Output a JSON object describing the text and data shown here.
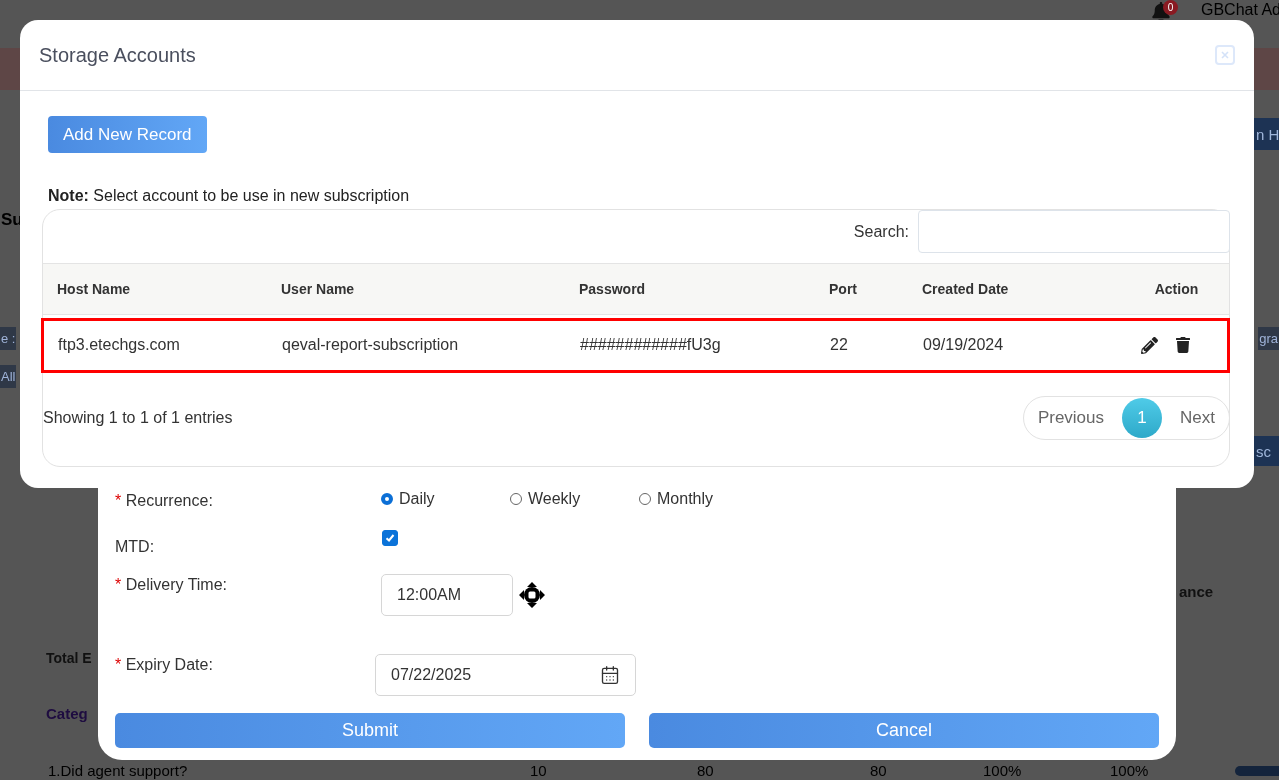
{
  "background_page": {
    "notification_badge": "0",
    "user_label": "GBChat Ad",
    "top_button": "n H",
    "heading": "Su",
    "left_chips": [
      "e :",
      "All"
    ],
    "right_chip": "gra",
    "right_button": "sc",
    "side_header": "ance",
    "total_label": "Total E",
    "category_label": "Categ",
    "progress_bar": {
      "level": 1
    },
    "table_row": [
      "1.Did agent support?",
      "10",
      "80",
      "80",
      "100%",
      "100%"
    ]
  },
  "subscription_form": {
    "fields": [
      {
        "kind": "radio",
        "required_mark": "*",
        "label": "Recurrence:",
        "options": [
          {
            "label": "Daily",
            "selected": true
          },
          {
            "label": "Weekly",
            "selected": false
          },
          {
            "label": "Monthly",
            "selected": false
          }
        ]
      },
      {
        "kind": "checkbox",
        "label": "MTD:",
        "checked": true
      },
      {
        "kind": "time",
        "required_mark": "*",
        "label": "Delivery Time:",
        "value": "12:00AM"
      },
      {
        "kind": "date",
        "required_mark": "*",
        "label": "Expiry Date:",
        "value": "07/22/2025"
      }
    ],
    "buttons": [
      "Submit",
      "Cancel"
    ]
  },
  "storage_modal": {
    "title": "Storage Accounts",
    "add_button": "Add New Record",
    "note": "**Note:** Select account to be use in new subscription",
    "search_label": "Search:",
    "columns": [
      "Host Name",
      "User Name",
      "Password",
      "Port",
      "Created Date",
      "Action"
    ],
    "rows": [
      {
        "selected": true,
        "cells": [
          "ftp3.etechgs.com",
          "qeval-report-subscription",
          "############fU3g",
          "22",
          "09/19/2024"
        ]
      }
    ],
    "info": "Showing 1 to 1 of 1 entries",
    "pagination": [
      {
        "label": "Previous",
        "selected": false
      },
      {
        "label": "1",
        "selected": true
      },
      {
        "label": "Next",
        "selected": false
      }
    ]
  }
}
